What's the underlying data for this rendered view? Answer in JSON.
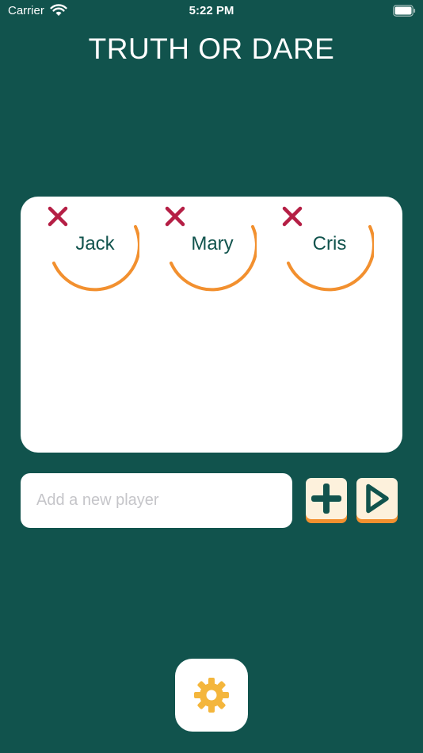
{
  "status_bar": {
    "carrier": "Carrier",
    "time": "5:22 PM",
    "wifi_icon": "wifi-icon",
    "battery_icon": "battery-icon"
  },
  "header": {
    "title": "TRUTH OR DARE"
  },
  "players": [
    {
      "name": "Jack"
    },
    {
      "name": "Mary"
    },
    {
      "name": "Cris"
    }
  ],
  "add_player": {
    "placeholder": "Add a new player",
    "value": ""
  },
  "icons": {
    "remove": "close-icon",
    "add": "plus-icon",
    "start": "play-icon",
    "settings": "gear-icon"
  },
  "colors": {
    "background": "#11534d",
    "accent_orange": "#f2902f",
    "remove_red": "#b51f45",
    "button_cream": "#fdf1dc",
    "gear_yellow": "#f4b63c"
  }
}
